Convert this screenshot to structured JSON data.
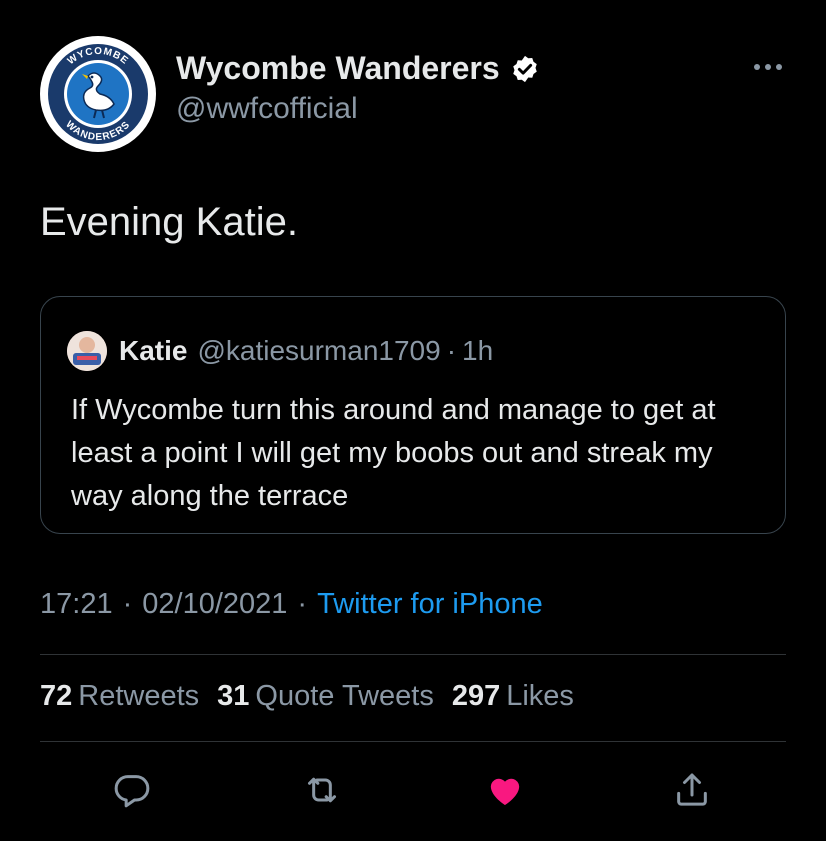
{
  "author": {
    "name": "Wycombe Wanderers",
    "handle": "@wwfcofficial",
    "logo_text_top": "WYCOMBE",
    "logo_text_bottom": "WANDERERS",
    "verified": true
  },
  "more_icon": "more-horizontal-icon",
  "tweet": {
    "text": "Evening Katie."
  },
  "quoted_tweet": {
    "name": "Katie",
    "handle": "@katiesurman1709",
    "separator": "·",
    "time": "1h",
    "text": "If Wycombe turn this around and manage to get at least a point I will get my boobs out and streak my way along the terrace"
  },
  "meta": {
    "time": "17:21",
    "separator": "·",
    "date": "02/10/2021",
    "source": "Twitter for iPhone"
  },
  "stats": [
    {
      "count": "72",
      "label": "Retweets"
    },
    {
      "count": "31",
      "label": "Quote Tweets"
    },
    {
      "count": "297",
      "label": "Likes"
    }
  ],
  "actions": [
    "reply-icon",
    "retweet-icon",
    "like-icon",
    "share-icon"
  ],
  "colors": {
    "background": "#000000",
    "text": "#e7e9ea",
    "secondary": "#8b98a5",
    "link": "#1d9bf0",
    "like": "#f91880",
    "badge": "#ffffff",
    "club_blue": "#1f74c4"
  }
}
